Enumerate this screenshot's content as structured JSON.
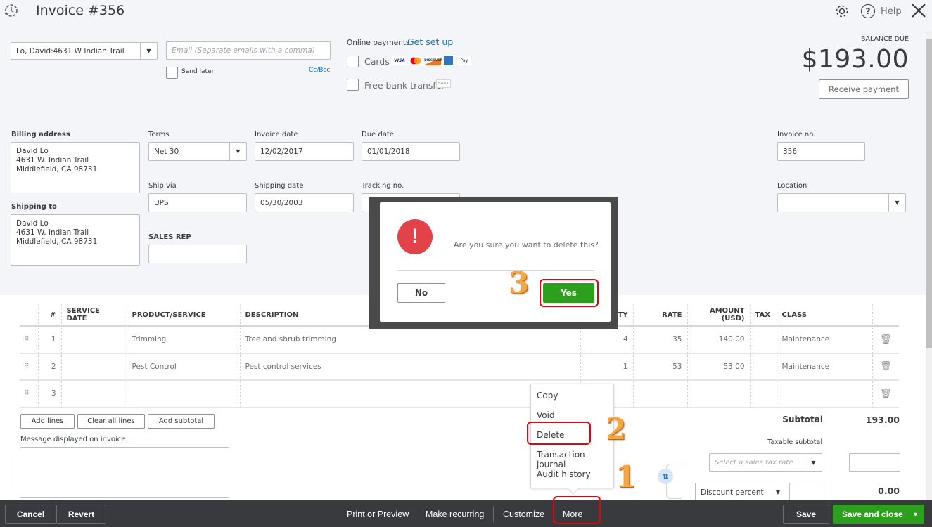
{
  "header": {
    "title": "Invoice #356",
    "help_label": "Help",
    "icons": [
      "recent-transactions-icon",
      "gear-icon",
      "help-icon",
      "close-icon"
    ]
  },
  "customer": {
    "selected": "Lo, David:4631 W Indian Trail",
    "email_placeholder": "Email (Separate emails with a comma)",
    "send_later_label": "Send later",
    "cc_bcc_label": "Cc/Bcc"
  },
  "online_payments": {
    "label": "Online payments",
    "setup_link": "Get set up",
    "cards_label": "Cards",
    "card_logos": [
      "VISA",
      "MC",
      "DISCOVER",
      "AMEX",
      "Pay"
    ],
    "bank_label": "Free bank transfer",
    "bank_badge": "BANK"
  },
  "balance": {
    "label": "BALANCE DUE",
    "amount": "$193.00",
    "receive_payment": "Receive payment"
  },
  "form": {
    "billing_address_label": "Billing address",
    "billing_address": "David Lo\n4631 W. Indian Trail\nMiddlefield, CA  98731",
    "shipping_to_label": "Shipping to",
    "shipping_to": "David Lo\n4631 W. Indian Trail\nMiddlefield, CA  98731",
    "terms_label": "Terms",
    "terms_value": "Net 30",
    "invoice_date_label": "Invoice date",
    "invoice_date": "12/02/2017",
    "due_date_label": "Due date",
    "due_date": "01/01/2018",
    "ship_via_label": "Ship via",
    "ship_via": "UPS",
    "shipping_date_label": "Shipping date",
    "shipping_date": "05/30/2003",
    "tracking_label": "Tracking no.",
    "tracking_value": "",
    "sales_rep_label": "SALES REP",
    "sales_rep_value": "",
    "invoice_no_label": "Invoice no.",
    "invoice_no": "356",
    "location_label": "Location",
    "location_value": ""
  },
  "table": {
    "headers": [
      "#",
      "SERVICE DATE",
      "PRODUCT/SERVICE",
      "DESCRIPTION",
      "QTY",
      "RATE",
      "AMOUNT (USD)",
      "TAX",
      "CLASS"
    ],
    "rows": [
      {
        "num": "1",
        "service_date": "",
        "product": "Trimming",
        "description": "Tree and shrub trimming",
        "qty": "4",
        "rate": "35",
        "amount": "140.00",
        "tax": "",
        "class": "Maintenance"
      },
      {
        "num": "2",
        "service_date": "",
        "product": "Pest Control",
        "description": "Pest control services",
        "qty": "1",
        "rate": "53",
        "amount": "53.00",
        "tax": "",
        "class": "Maintenance"
      },
      {
        "num": "3",
        "service_date": "",
        "product": "",
        "description": "",
        "qty": "",
        "rate": "",
        "amount": "",
        "tax": "",
        "class": ""
      }
    ]
  },
  "line_buttons": {
    "add_lines": "Add lines",
    "clear_all": "Clear all lines",
    "add_subtotal": "Add subtotal"
  },
  "message_label": "Message displayed on invoice",
  "totals": {
    "subtotal_label": "Subtotal",
    "subtotal": "193.00",
    "taxable_subtotal_label": "Taxable subtotal",
    "tax_rate_placeholder": "Select a sales tax rate",
    "discount_type": "Discount percent",
    "discount_amount": "0.00"
  },
  "more_menu": {
    "items": [
      "Copy",
      "Void",
      "Delete",
      "Transaction journal",
      "Audit history"
    ]
  },
  "dialog": {
    "message": "Are you sure you want to delete this?",
    "no_label": "No",
    "yes_label": "Yes"
  },
  "footer": {
    "cancel": "Cancel",
    "revert": "Revert",
    "print_preview": "Print or Preview",
    "make_recurring": "Make recurring",
    "customize": "Customize",
    "more": "More",
    "save": "Save",
    "save_close": "Save and close"
  },
  "annotations": {
    "step1": "1",
    "step2": "2",
    "step3": "3"
  },
  "colors": {
    "accent_green": "#2ca01c",
    "link_blue": "#0077c5",
    "alert_red": "#e2424a",
    "annotation_red": "#e8000b",
    "annotation_orange": "#f7a540"
  }
}
